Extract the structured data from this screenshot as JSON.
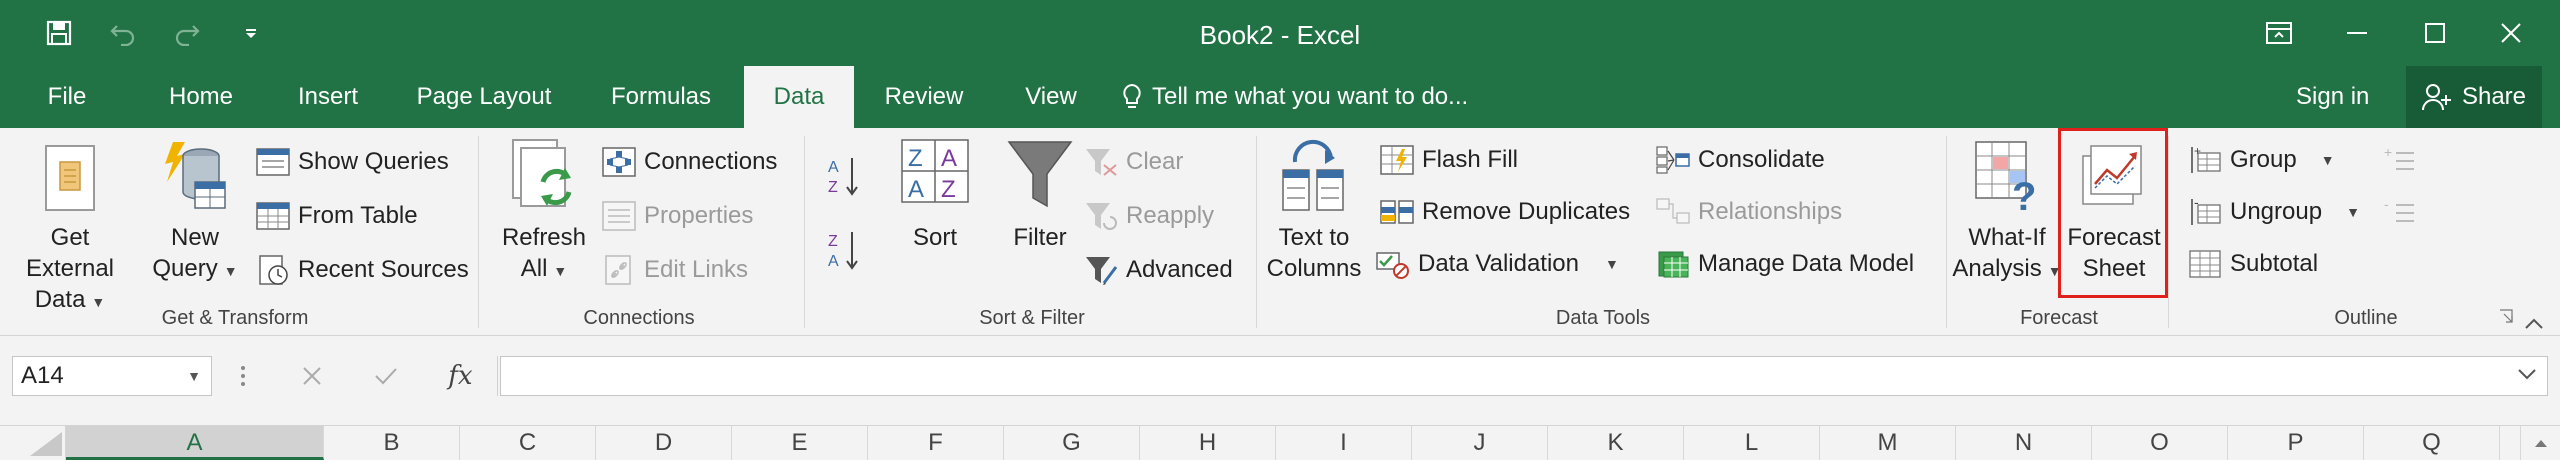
{
  "window": {
    "title": "Book2 - Excel"
  },
  "tabs": [
    {
      "label": "File",
      "active": false
    },
    {
      "label": "Home",
      "active": false
    },
    {
      "label": "Insert",
      "active": false
    },
    {
      "label": "Page Layout",
      "active": false
    },
    {
      "label": "Formulas",
      "active": false
    },
    {
      "label": "Data",
      "active": true
    },
    {
      "label": "Review",
      "active": false
    },
    {
      "label": "View",
      "active": false
    }
  ],
  "tellme": "Tell me what you want to do...",
  "signin": "Sign in",
  "share": "Share",
  "groups": {
    "get_transform": {
      "label": "Get & Transform",
      "get_external_data": [
        "Get External",
        "Data"
      ],
      "new_query": [
        "New",
        "Query"
      ],
      "show_queries": "Show Queries",
      "from_table": "From Table",
      "recent_sources": "Recent Sources"
    },
    "connections": {
      "label": "Connections",
      "refresh_all": [
        "Refresh",
        "All"
      ],
      "connections": "Connections",
      "properties": "Properties",
      "edit_links": "Edit Links"
    },
    "sort_filter": {
      "label": "Sort & Filter",
      "sort": "Sort",
      "filter": "Filter",
      "clear": "Clear",
      "reapply": "Reapply",
      "advanced": "Advanced"
    },
    "data_tools": {
      "label": "Data Tools",
      "text_to_columns": [
        "Text to",
        "Columns"
      ],
      "flash_fill": "Flash Fill",
      "remove_duplicates": "Remove Duplicates",
      "data_validation": "Data Validation",
      "consolidate": "Consolidate",
      "relationships": "Relationships",
      "manage_data_model": "Manage Data Model"
    },
    "forecast": {
      "label": "Forecast",
      "what_if": [
        "What-If",
        "Analysis"
      ],
      "forecast_sheet": [
        "Forecast",
        "Sheet"
      ]
    },
    "outline": {
      "label": "Outline",
      "group": "Group",
      "ungroup": "Ungroup",
      "subtotal": "Subtotal"
    }
  },
  "formula_bar": {
    "name_box": "A14",
    "fx": "fx",
    "value": ""
  },
  "columns": [
    "A",
    "B",
    "C",
    "D",
    "E",
    "F",
    "G",
    "H",
    "I",
    "J",
    "K",
    "L",
    "M",
    "N",
    "O",
    "P",
    "Q"
  ],
  "selected_column": "A",
  "colors": {
    "excel_green": "#217346",
    "highlight_red": "#e0201b",
    "ribbon_bg": "#f3f3f3"
  }
}
